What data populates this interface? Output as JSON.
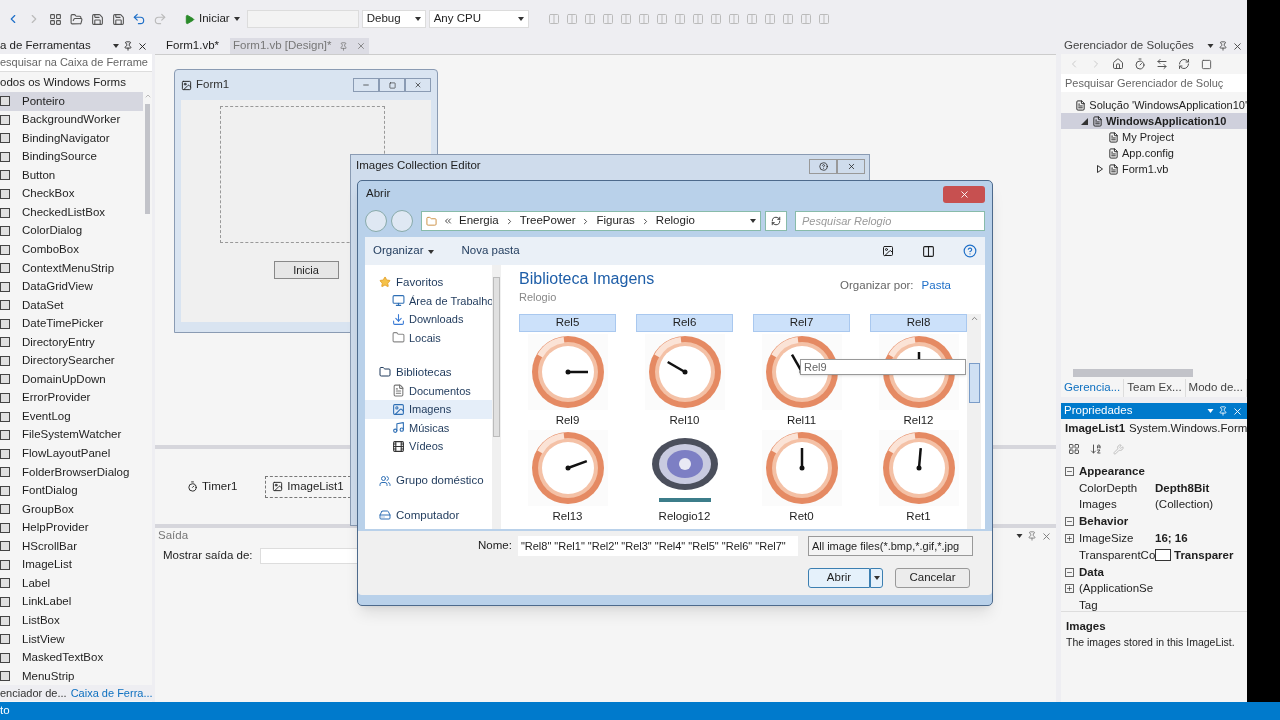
{
  "toolbar": {
    "start_label": "Iniciar",
    "configuration": "Debug",
    "platform": "Any CPU"
  },
  "toolbox": {
    "title": "a de Ferramentas",
    "search_placeholder": "esquisar na Caixa de Ferrame",
    "group": "odos os Windows Forms",
    "items": [
      {
        "label": "Ponteiro",
        "selected": true
      },
      {
        "label": "BackgroundWorker",
        "selected": false
      },
      {
        "label": "BindingNavigator",
        "selected": false
      },
      {
        "label": "BindingSource",
        "selected": false
      },
      {
        "label": "Button",
        "selected": false
      },
      {
        "label": "CheckBox",
        "selected": false
      },
      {
        "label": "CheckedListBox",
        "selected": false
      },
      {
        "label": "ColorDialog",
        "selected": false
      },
      {
        "label": "ComboBox",
        "selected": false
      },
      {
        "label": "ContextMenuStrip",
        "selected": false
      },
      {
        "label": "DataGridView",
        "selected": false
      },
      {
        "label": "DataSet",
        "selected": false
      },
      {
        "label": "DateTimePicker",
        "selected": false
      },
      {
        "label": "DirectoryEntry",
        "selected": false
      },
      {
        "label": "DirectorySearcher",
        "selected": false
      },
      {
        "label": "DomainUpDown",
        "selected": false
      },
      {
        "label": "ErrorProvider",
        "selected": false
      },
      {
        "label": "EventLog",
        "selected": false
      },
      {
        "label": "FileSystemWatcher",
        "selected": false
      },
      {
        "label": "FlowLayoutPanel",
        "selected": false
      },
      {
        "label": "FolderBrowserDialog",
        "selected": false
      },
      {
        "label": "FontDialog",
        "selected": false
      },
      {
        "label": "GroupBox",
        "selected": false
      },
      {
        "label": "HelpProvider",
        "selected": false
      },
      {
        "label": "HScrollBar",
        "selected": false
      },
      {
        "label": "ImageList",
        "selected": false
      },
      {
        "label": "Label",
        "selected": false
      },
      {
        "label": "LinkLabel",
        "selected": false
      },
      {
        "label": "ListBox",
        "selected": false
      },
      {
        "label": "ListView",
        "selected": false
      },
      {
        "label": "MaskedTextBox",
        "selected": false
      },
      {
        "label": "MenuStrip",
        "selected": false
      }
    ],
    "bottom_tabs": [
      {
        "label": "enciador de...",
        "selected": false
      },
      {
        "label": "Caixa de Ferra...",
        "selected": true
      }
    ]
  },
  "document_tabs": [
    {
      "label": "Form1.vb*",
      "selected": false
    },
    {
      "label": "Form1.vb [Design]*",
      "selected": true
    }
  ],
  "designer": {
    "form_title": "Form1",
    "button": "Inicia",
    "components": [
      {
        "label": "Timer1",
        "selected": false
      },
      {
        "label": "ImageList1",
        "selected": true
      }
    ]
  },
  "output": {
    "title": "Saída",
    "source_label": "Mostrar saída de:"
  },
  "collection_editor": {
    "title": "Images Collection Editor"
  },
  "open_dialog": {
    "title": "Abrir",
    "path": [
      "Energia",
      "TreePower",
      "Figuras",
      "Relogio"
    ],
    "search_placeholder": "Pesquisar Relogio",
    "commands": [
      "Organizar",
      "Nova pasta"
    ],
    "nav": [
      {
        "label": "Favoritos",
        "children": [
          {
            "label": "Área de Trabalho",
            "selected": false
          },
          {
            "label": "Downloads",
            "selected": false
          },
          {
            "label": "Locais",
            "selected": false
          }
        ]
      },
      {
        "label": "Bibliotecas",
        "children": [
          {
            "label": "Documentos",
            "selected": false
          },
          {
            "label": "Imagens",
            "selected": true
          },
          {
            "label": "Músicas",
            "selected": false
          },
          {
            "label": "Vídeos",
            "selected": false
          }
        ]
      },
      {
        "label": "Grupo doméstico"
      },
      {
        "label": "Computador"
      }
    ],
    "library_title": "Biblioteca Imagens",
    "library_subtitle": "Relogio",
    "arrange_label": "Organizar por:",
    "arrange_value": "Pasta",
    "partial_items": [
      {
        "label": "Rel5",
        "selected": true
      },
      {
        "label": "Rel6",
        "selected": true
      },
      {
        "label": "Rel7",
        "selected": true
      },
      {
        "label": "Rel8",
        "selected": true
      }
    ],
    "items": [
      {
        "label": "Rel9",
        "kind": "clock",
        "selected": false
      },
      {
        "label": "Rel10",
        "kind": "clock",
        "selected": false
      },
      {
        "label": "Rel11",
        "kind": "clock",
        "selected": false
      },
      {
        "label": "Rel12",
        "kind": "clock",
        "selected": false
      },
      {
        "label": "Rel13",
        "kind": "clock",
        "selected": false
      },
      {
        "label": "Relogio12",
        "kind": "dial",
        "selected": false
      },
      {
        "label": "Ret0",
        "kind": "clock",
        "selected": false
      },
      {
        "label": "Ret1",
        "kind": "clock",
        "selected": false
      }
    ],
    "tooltip": "Rel9",
    "name_label": "Nome:",
    "name_value": "\"Rel8\" \"Rel1\" \"Rel2\" \"Rel3\" \"Rel4\" \"Rel5\" \"Rel6\" \"Rel7\"",
    "filter": "All image files(*.bmp,*.gif,*.jpg",
    "buttons": [
      "Abrir",
      "Cancelar"
    ]
  },
  "solution_explorer": {
    "title": "Gerenciador de Soluções",
    "search_placeholder": "Pesquisar Gerenciador de Soluç",
    "tree": [
      {
        "label": "Solução 'WindowsApplication10'",
        "selected": false,
        "children": [
          {
            "label": "WindowsApplication10",
            "selected": true,
            "expanded": true,
            "children": [
              {
                "label": "My Project",
                "selected": false
              },
              {
                "label": "App.config",
                "selected": false
              },
              {
                "label": "Form1.vb",
                "selected": false,
                "expanded": false
              }
            ]
          }
        ]
      }
    ],
    "tabs": [
      {
        "label": "Gerencia...",
        "selected": true
      },
      {
        "label": "Team Ex...",
        "selected": false
      },
      {
        "label": "Modo de...",
        "selected": false
      }
    ]
  },
  "properties": {
    "title": "Propriedades",
    "object": "ImageList1",
    "type": "System.Windows.Form",
    "categories": [
      {
        "name": "Appearance",
        "expanded": true,
        "rows": [
          {
            "name": "ColorDepth",
            "value": "Depth8Bit",
            "bold": true
          },
          {
            "name": "Images",
            "value": "(Collection)",
            "bold": false
          }
        ]
      },
      {
        "name": "Behavior",
        "expanded": true,
        "rows": [
          {
            "name": "ImageSize",
            "value": "16; 16",
            "bold": true,
            "expandable": true
          },
          {
            "name": "TransparentCo",
            "value": "Transparer",
            "bold": true,
            "color": "#ffffff"
          }
        ]
      },
      {
        "name": "Data",
        "expanded": true,
        "rows": [
          {
            "name": "(ApplicationSe",
            "expandable": true
          },
          {
            "name": "Tag"
          }
        ]
      }
    ],
    "description_title": "Images",
    "description": "The images stored in this ImageList."
  },
  "status_bar": {
    "text": "to"
  }
}
